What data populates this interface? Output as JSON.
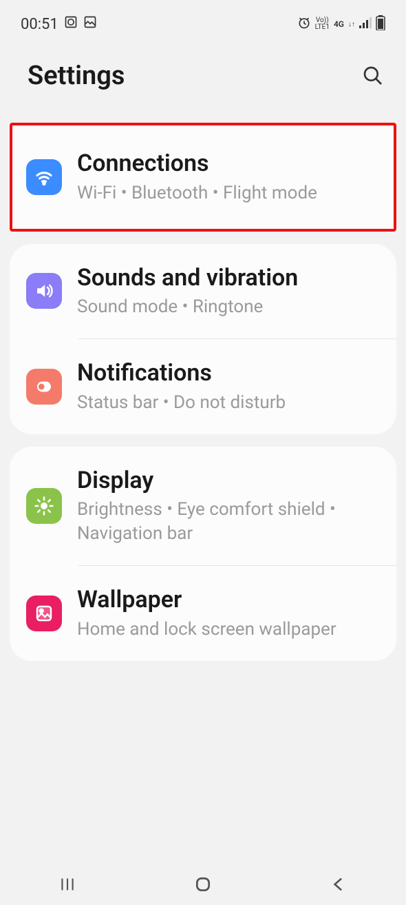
{
  "status": {
    "time": "00:51",
    "net_label": "Vo))\nLTE1",
    "net_type": "4G"
  },
  "header": {
    "title": "Settings"
  },
  "groups": [
    {
      "highlighted": true,
      "items": [
        {
          "id": "connections",
          "icon": "wifi",
          "color": "blue",
          "title": "Connections",
          "subtitle": "Wi-Fi  •  Bluetooth  •  Flight mode"
        }
      ]
    },
    {
      "highlighted": false,
      "items": [
        {
          "id": "sounds",
          "icon": "volume",
          "color": "purple",
          "title": "Sounds and vibration",
          "subtitle": "Sound mode  •  Ringtone"
        },
        {
          "id": "notifications",
          "icon": "bell",
          "color": "coral",
          "title": "Notifications",
          "subtitle": "Status bar  •  Do not disturb"
        }
      ]
    },
    {
      "highlighted": false,
      "items": [
        {
          "id": "display",
          "icon": "sun",
          "color": "green",
          "title": "Display",
          "subtitle": "Brightness  •  Eye comfort shield  •  Navigation bar"
        },
        {
          "id": "wallpaper",
          "icon": "image",
          "color": "pink",
          "title": "Wallpaper",
          "subtitle": "Home and lock screen wallpaper"
        }
      ]
    }
  ]
}
